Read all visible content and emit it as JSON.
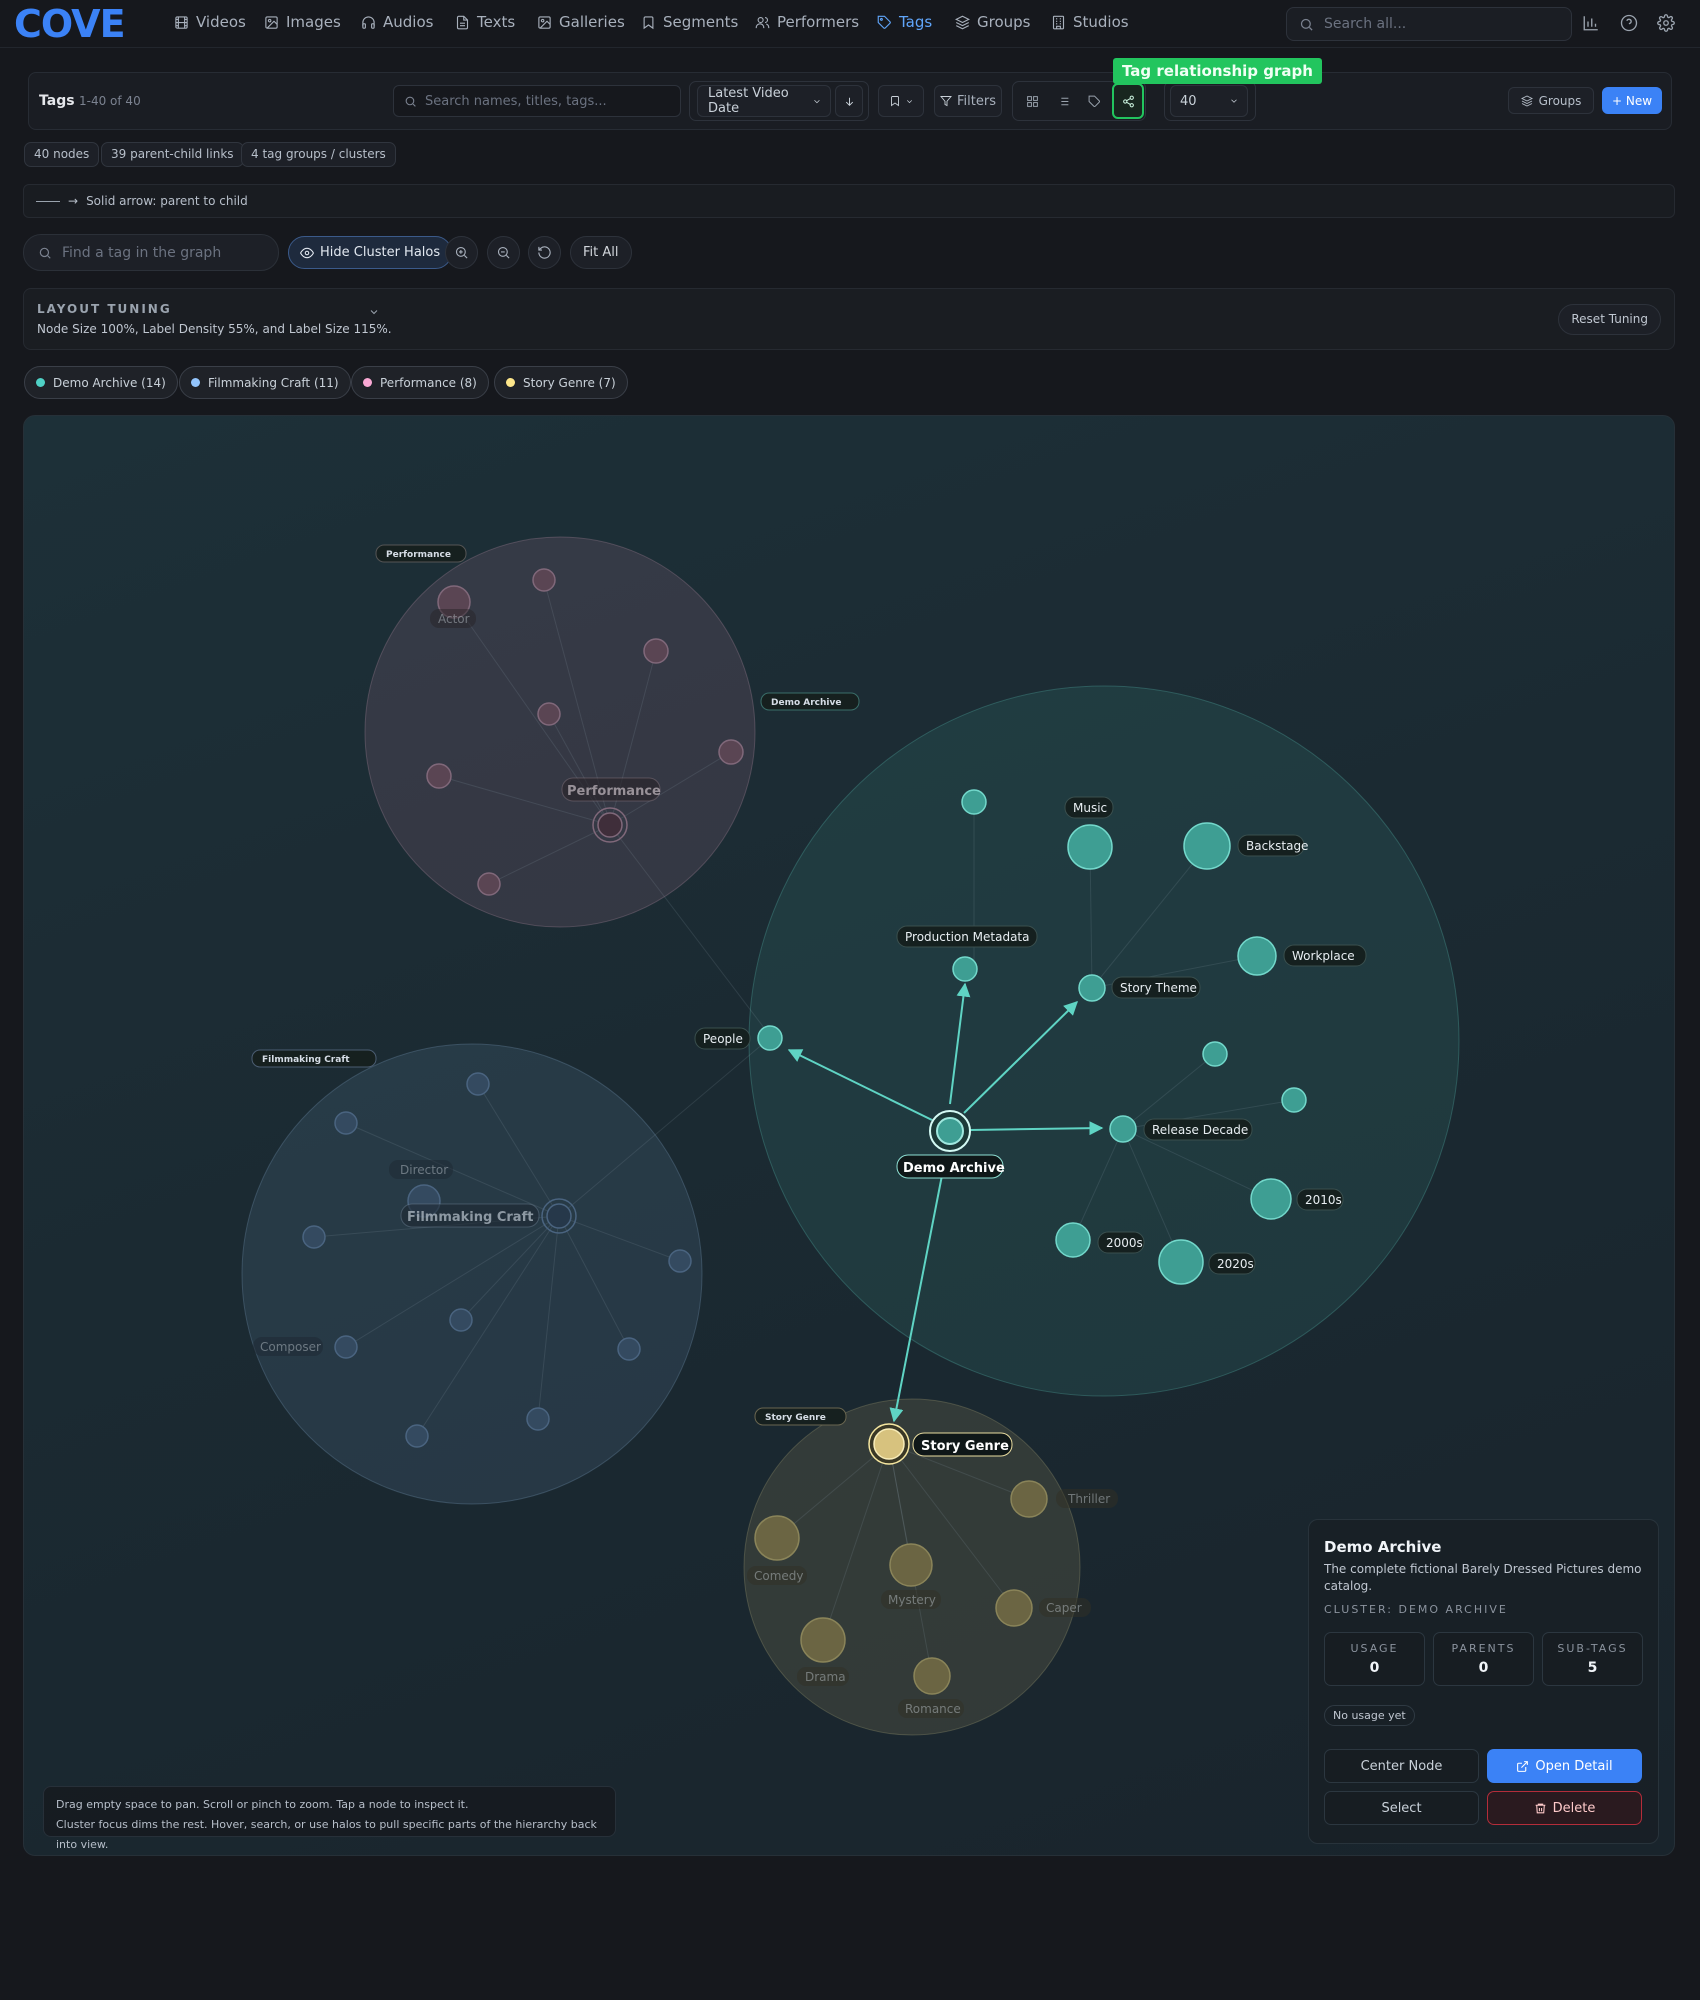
{
  "app": {
    "logo": "COVE"
  },
  "nav": {
    "items": [
      {
        "label": "Videos",
        "icon": "film-icon"
      },
      {
        "label": "Images",
        "icon": "image-icon"
      },
      {
        "label": "Audios",
        "icon": "headphones-icon"
      },
      {
        "label": "Texts",
        "icon": "file-text-icon"
      },
      {
        "label": "Galleries",
        "icon": "gallery-icon"
      },
      {
        "label": "Segments",
        "icon": "bookmark-icon"
      },
      {
        "label": "Performers",
        "icon": "users-icon"
      },
      {
        "label": "Tags",
        "icon": "tag-icon",
        "active": true
      },
      {
        "label": "Groups",
        "icon": "layers-icon"
      },
      {
        "label": "Studios",
        "icon": "building-icon"
      }
    ],
    "search_placeholder": "Search all..."
  },
  "toolbar": {
    "title": "Tags",
    "count": "1-40 of 40",
    "search_placeholder": "Search names, titles, tags...",
    "sort_label": "Latest Video Date",
    "filters_label": "Filters",
    "per_page": "40",
    "groups_label": "Groups",
    "new_label": "+ New",
    "tooltip": "Tag relationship graph"
  },
  "stats_chips": [
    "40 nodes",
    "39 parent-child links",
    "4 tag groups / clusters"
  ],
  "legend": {
    "text": "Solid arrow: parent to child"
  },
  "graph_controls": {
    "search_placeholder": "Find a tag in the graph",
    "halo_label": "Hide Cluster Halos",
    "fit_label": "Fit All"
  },
  "tuning": {
    "title": "LAYOUT TUNING",
    "desc": "Node Size 100%, Label Density 55%, and Label Size 115%.",
    "reset_label": "Reset Tuning"
  },
  "clusters": [
    {
      "label": "Demo Archive (14)",
      "color": "#4fd1c5"
    },
    {
      "label": "Filmmaking Craft (11)",
      "color": "#93c5fd"
    },
    {
      "label": "Performance (8)",
      "color": "#f9a8d4"
    },
    {
      "label": "Story Genre (7)",
      "color": "#fde68a"
    }
  ],
  "graph": {
    "halo_labels": {
      "performance": "Performance",
      "demo": "Demo Archive",
      "filmmaking": "Filmmaking Craft",
      "genre": "Story Genre"
    },
    "node_labels": {
      "music": "Music",
      "backstage": "Backstage",
      "production_metadata": "Production Metadata",
      "story_theme": "Story Theme",
      "workplace": "Workplace",
      "people": "People",
      "release_decade": "Release Decade",
      "demo_archive": "Demo Archive",
      "d2010s": "2010s",
      "d2000s": "2000s",
      "d2020s": "2020s",
      "performance": "Performance",
      "actor": "Actor",
      "filmmaking_craft": "Filmmaking Craft",
      "director": "Director",
      "composer": "Composer",
      "story_genre": "Story Genre",
      "thriller": "Thriller",
      "comedy": "Comedy",
      "mystery": "Mystery",
      "caper": "Caper",
      "drama": "Drama",
      "romance": "Romance"
    }
  },
  "hint": {
    "line1": "Drag empty space to pan. Scroll or pinch to zoom. Tap a node to inspect it.",
    "line2": "Cluster focus dims the rest. Hover, search, or use halos to pull specific parts of the hierarchy back into view."
  },
  "detail": {
    "title": "Demo Archive",
    "description": "The complete fictional Barely Dressed Pictures demo catalog.",
    "cluster": "CLUSTER: DEMO ARCHIVE",
    "stats": [
      {
        "label": "USAGE",
        "value": "0"
      },
      {
        "label": "PARENTS",
        "value": "0"
      },
      {
        "label": "SUB-TAGS",
        "value": "5"
      }
    ],
    "usage_note": "No usage yet",
    "center_label": "Center Node",
    "open_label": "Open Detail",
    "select_label": "Select",
    "delete_label": "Delete"
  }
}
